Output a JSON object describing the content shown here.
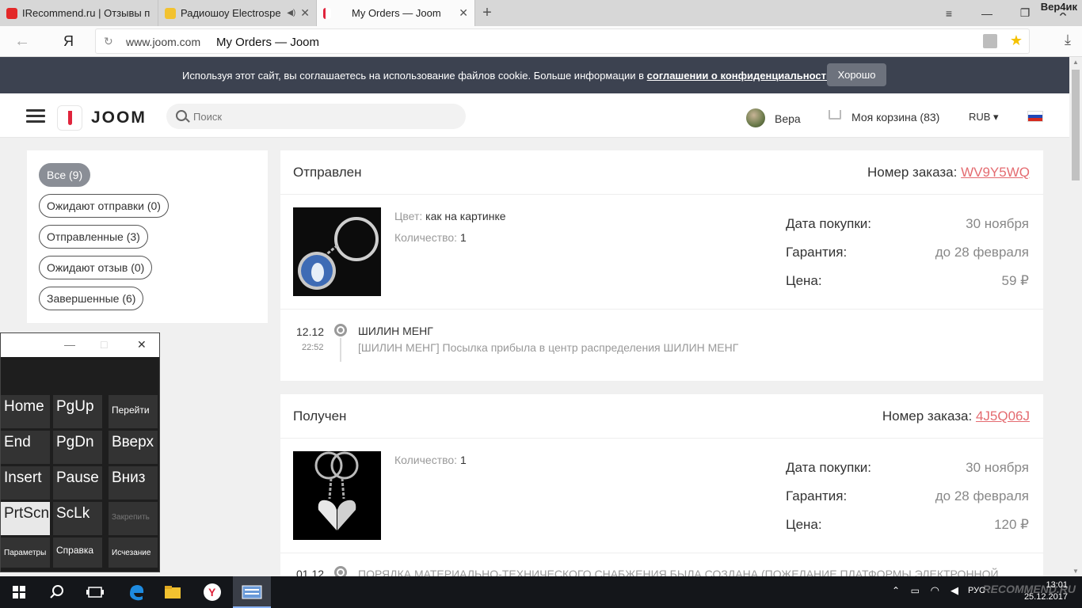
{
  "browser": {
    "tabs": [
      {
        "label": "IRecommend.ru | Отзывы п",
        "favicon_color": "#e32828",
        "active": false
      },
      {
        "label": "Радиошоу Electrospe",
        "favicon_color": "#f2c230",
        "active": false
      },
      {
        "label": "My Orders — Joom",
        "favicon_color": "#ffffff",
        "active": true
      }
    ],
    "user_label": "Вер4ик",
    "address": {
      "domain": "www.joom.com",
      "title": "My Orders — Joom"
    },
    "yandex_label": "Я"
  },
  "cookie_banner": {
    "text": "Используя этот сайт, вы соглашаетесь на использование файлов cookie. Больше информации в ",
    "link_text": "соглашении о конфиденциальности",
    "suffix": ".",
    "ok_label": "Хорошо"
  },
  "header": {
    "logo": "JOOM",
    "search_placeholder": "Поиск",
    "user_name": "Вера",
    "cart_label": "Моя корзина (83)",
    "currency": "RUB ▾"
  },
  "filters": [
    {
      "label": "Все (9)",
      "active": true
    },
    {
      "label": "Ожидают отправки (0)",
      "active": false
    },
    {
      "label": "Отправленные (3)",
      "active": false
    },
    {
      "label": "Ожидают отзыв (0)",
      "active": false
    },
    {
      "label": "Завершенные (6)",
      "active": false
    }
  ],
  "orders": [
    {
      "status": "Отправлен",
      "number_label": "Номер заказа:",
      "number": "WV9Y5WQ",
      "color_label": "Цвет:",
      "color_value": "как на картинке",
      "qty_label": "Количество:",
      "qty_value": "1",
      "purchase_label": "Дата покупки:",
      "purchase_value": "30 ноября",
      "warranty_label": "Гарантия:",
      "warranty_value": "до 28 февраля",
      "price_label": "Цена:",
      "price_value": "59 ₽",
      "tracking": {
        "date": "12.12",
        "time": "22:52",
        "title": "ШИЛИН МЕНГ",
        "description": "[ШИЛИН МЕНГ] Посылка прибыла в центр распределения ШИЛИН МЕНГ"
      }
    },
    {
      "status": "Получен",
      "number_label": "Номер заказа:",
      "number": "4J5Q06J",
      "qty_label": "Количество:",
      "qty_value": "1",
      "purchase_label": "Дата покупки:",
      "purchase_value": "30 ноября",
      "warranty_label": "Гарантия:",
      "warranty_value": "до 28 февраля",
      "price_label": "Цена:",
      "price_value": "120 ₽",
      "tracking": {
        "date": "01.12",
        "title": "ПОРЯДКА МАТЕРИАЛЬНО-ТЕХНИЧЕСКОГО СНАБЖЕНИЯ БЫЛА СОЗДАНА (ПОЖЕЛАНИЕ ПЛАТФОРМЫ ЭЛЕКТРОННОЙ"
      }
    }
  ],
  "osk": {
    "keys": [
      "Home",
      "PgUp",
      "Перейти",
      "End",
      "PgDn",
      "Вверх",
      "Insert",
      "Pause",
      "Вниз",
      "PrtScn",
      "ScLk",
      "Закрепить",
      "Параметры",
      "Справка",
      "Исчезание"
    ]
  },
  "taskbar": {
    "lang": "РУС",
    "time": "13:01",
    "date": "25.12.2017",
    "watermark": "RECOMMEND.RU"
  }
}
